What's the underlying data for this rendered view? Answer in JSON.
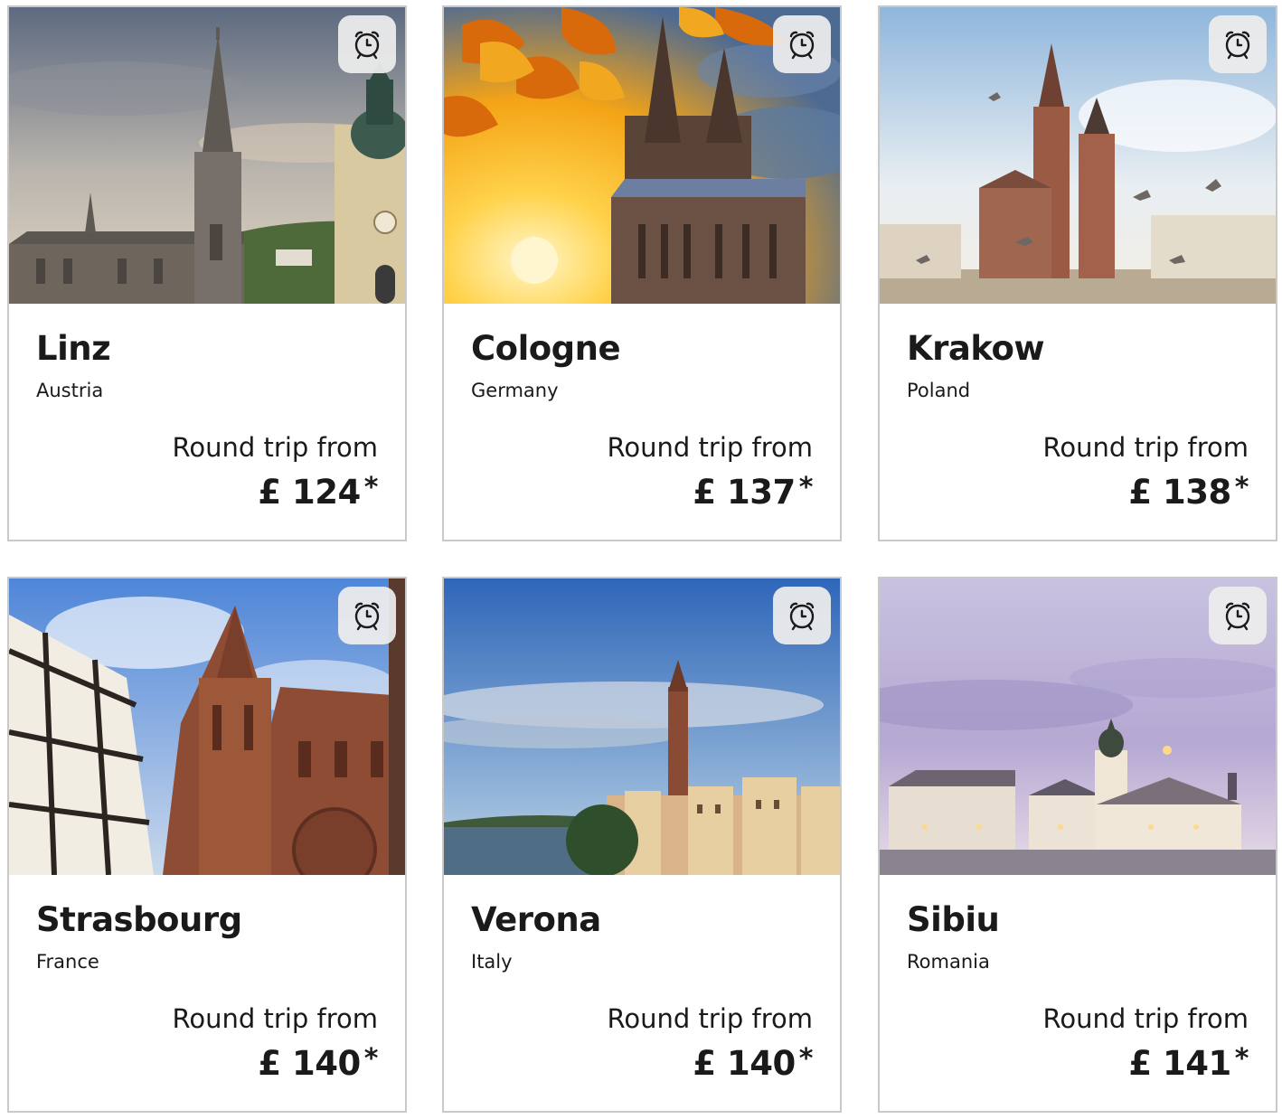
{
  "deals": [
    {
      "city": "Linz",
      "country": "Austria",
      "label": "Round trip from",
      "price": "£ 124",
      "asterisk": "*"
    },
    {
      "city": "Cologne",
      "country": "Germany",
      "label": "Round trip from",
      "price": "£ 137",
      "asterisk": "*"
    },
    {
      "city": "Krakow",
      "country": "Poland",
      "label": "Round trip from",
      "price": "£ 138",
      "asterisk": "*"
    },
    {
      "city": "Strasbourg",
      "country": "France",
      "label": "Round trip from",
      "price": "£ 140",
      "asterisk": "*"
    },
    {
      "city": "Verona",
      "country": "Italy",
      "label": "Round trip from",
      "price": "£ 140",
      "asterisk": "*"
    },
    {
      "city": "Sibiu",
      "country": "Romania",
      "label": "Round trip from",
      "price": "£ 141",
      "asterisk": "*"
    }
  ],
  "icons": {
    "alert_button": "alarm-clock-icon"
  }
}
